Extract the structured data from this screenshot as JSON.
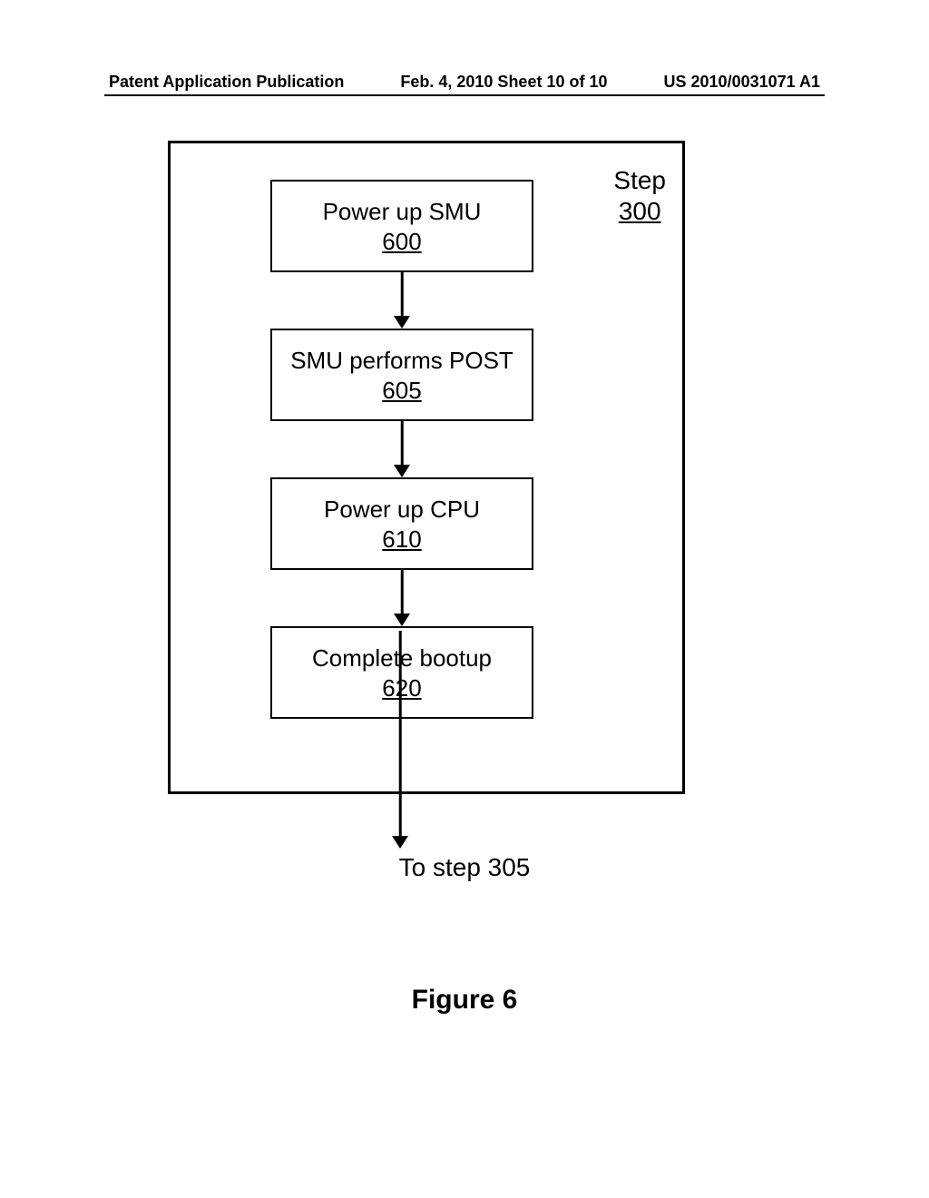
{
  "header": {
    "left": "Patent Application Publication",
    "center": "Feb. 4, 2010  Sheet 10 of 10",
    "right": "US 2010/0031071 A1"
  },
  "step_label": {
    "word": "Step",
    "num": "300"
  },
  "blocks": [
    {
      "title": "Power up SMU",
      "num": "600"
    },
    {
      "title": "SMU performs POST",
      "num": "605"
    },
    {
      "title": "Power up CPU",
      "num": "610"
    },
    {
      "title": "Complete bootup",
      "num": "620"
    }
  ],
  "exit_text": "To step 305",
  "figure_label": "Figure 6"
}
